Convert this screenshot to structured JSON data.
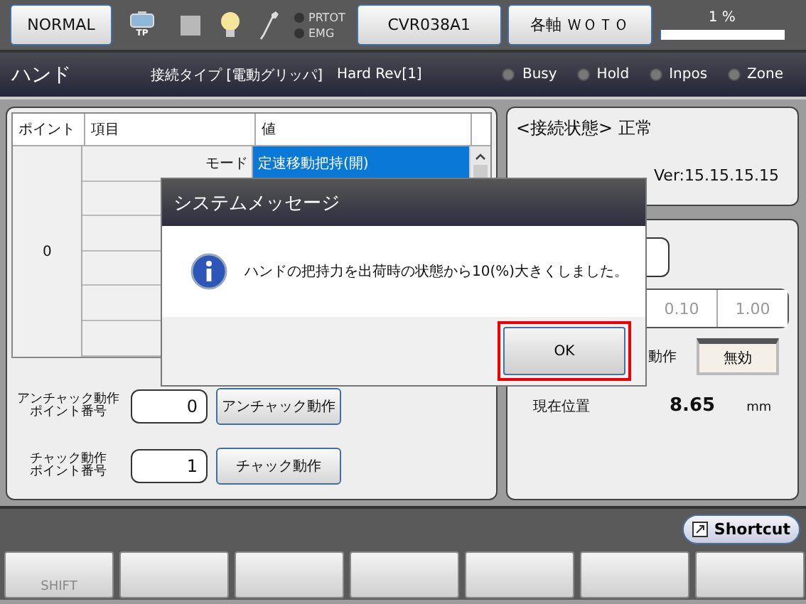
{
  "top_bar": {
    "mode_button": "NORMAL",
    "tp_label": "TP",
    "lamps": [
      {
        "label": "PRTOT",
        "on": false
      },
      {
        "label": "EMG",
        "on": false
      }
    ],
    "model_button": "CVR038A1",
    "axis_button": "各軸 ＷＯＴＯ",
    "override": {
      "reading": "1 %",
      "level": 0.01
    }
  },
  "header": {
    "title": "ハンド",
    "connection_type": "接続タイプ [電動グリッパ]",
    "hard_rev": "Hard Rev[1]",
    "indicators": [
      {
        "label": "Busy",
        "on": false
      },
      {
        "label": "Hold",
        "on": false
      },
      {
        "label": "Inpos",
        "on": false
      },
      {
        "label": "Zone",
        "on": false
      }
    ]
  },
  "table": {
    "columns": [
      "ポイント",
      "項目",
      "値"
    ],
    "point": "0",
    "rows": [
      {
        "item": "モード",
        "value": "定速移動把持(開)",
        "selected": true
      }
    ]
  },
  "unchuck": {
    "label": [
      "アンチャック動作",
      "ポイント番号"
    ],
    "value": "0",
    "button": "アンチャック動作"
  },
  "chuck": {
    "label": [
      "チャック動作",
      "ポイント番号"
    ],
    "value": "1",
    "button": "チャック動作"
  },
  "status_panel": {
    "connection": "<接続状態> 正常",
    "version": "Ver:15.15.15.15"
  },
  "jog_panel": {
    "steps": [
      "0.10",
      "1.00"
    ],
    "operation_label": "動作",
    "operation_button": "無効",
    "position_label": "現在位置",
    "position_value": "8.65",
    "position_unit": "mm"
  },
  "shortcut_button": "Shortcut",
  "function_keys": [
    {
      "label": "SHIFT",
      "disabled": true
    }
  ],
  "dialog": {
    "title": "システムメッセージ",
    "message": "ハンドの把持力を出荷時の状態から10(%)大きくしました。",
    "ok_button": "OK",
    "ok_highlighted": true
  }
}
